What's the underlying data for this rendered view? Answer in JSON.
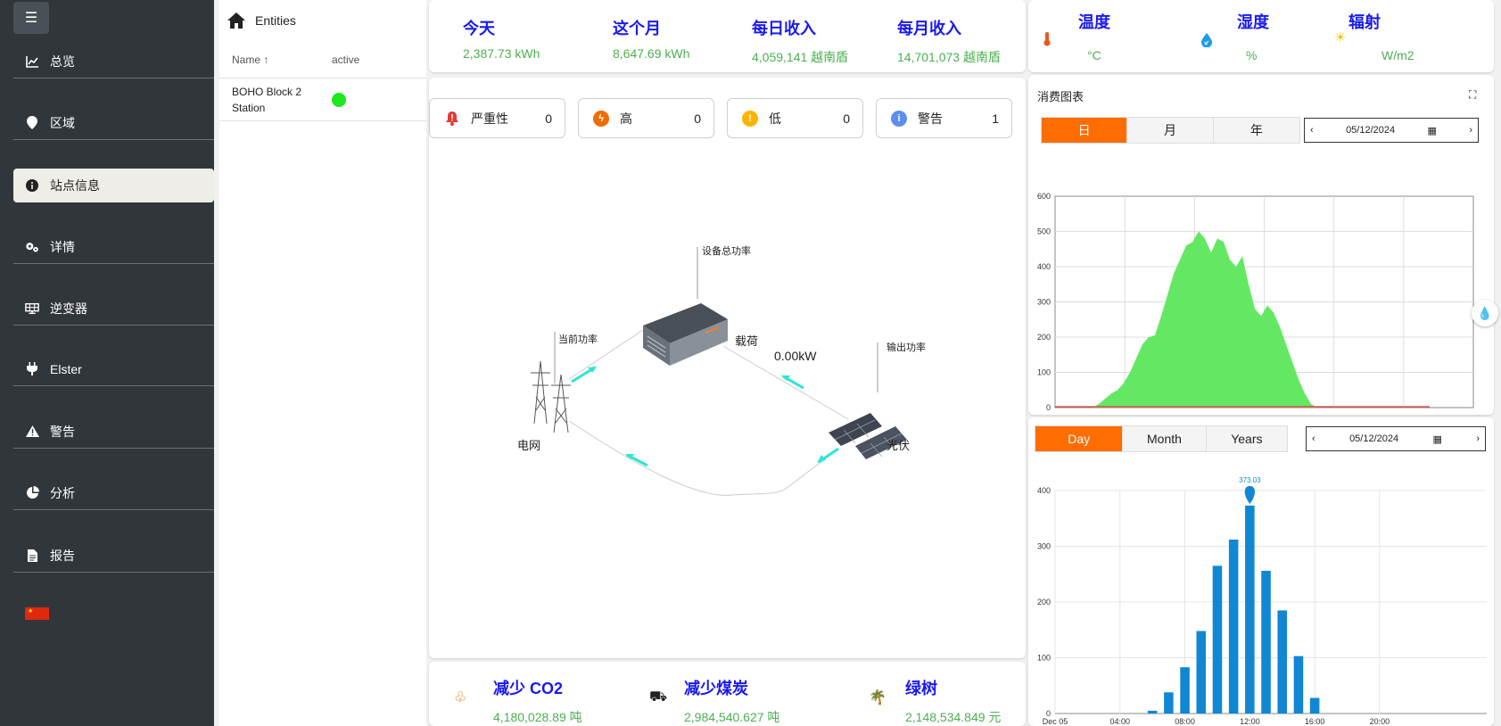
{
  "sidebar": {
    "menu_icon": "hamburger-icon",
    "items": [
      {
        "label": "总览",
        "icon": "line-chart-icon"
      },
      {
        "label": "区域",
        "icon": "map-pin-icon"
      },
      {
        "label": "站点信息",
        "icon": "info-icon",
        "active": true
      },
      {
        "label": "详情",
        "icon": "gears-icon"
      },
      {
        "label": "逆变器",
        "icon": "solar-panel-icon"
      },
      {
        "label": "Elster",
        "icon": "plug-icon"
      },
      {
        "label": "警告",
        "icon": "warning-icon"
      },
      {
        "label": "分析",
        "icon": "pie-chart-icon"
      },
      {
        "label": "报告",
        "icon": "document-icon"
      }
    ],
    "language_flag": "china-flag-icon"
  },
  "entities": {
    "title": "Entities",
    "columns": {
      "name": "Name ↑",
      "active": "active"
    },
    "rows": [
      {
        "name": "BOHO Block 2 Station",
        "active_color": "#1ee81e"
      }
    ]
  },
  "kpis": [
    {
      "label": "今天",
      "value": "2,387.73 kWh"
    },
    {
      "label": "这个月",
      "value": "8,647.69 kWh"
    },
    {
      "label": "每日收入",
      "value": "4,059,141 越南盾"
    },
    {
      "label": "每月收入",
      "value": "14,701,073 越南盾"
    }
  ],
  "weather": [
    {
      "label": "温度",
      "unit": "°C",
      "icon": "thermometer-icon"
    },
    {
      "label": "湿度",
      "unit": "%",
      "icon": "humidity-icon"
    },
    {
      "label": "辐射",
      "unit": "W/m2",
      "icon": "sun-icon"
    }
  ],
  "alarms": [
    {
      "label": "严重性",
      "count": "0",
      "icon": "bell-icon",
      "color": "#e53935"
    },
    {
      "label": "高",
      "count": "0",
      "icon": "bolt-icon",
      "color": "#ef6c00"
    },
    {
      "label": "低",
      "count": "0",
      "icon": "exclamation-icon",
      "color": "#ffb300"
    },
    {
      "label": "警告",
      "count": "1",
      "icon": "info-icon",
      "color": "#5c8ef2"
    }
  ],
  "diagram": {
    "device_power": "设备总功率",
    "current_power": "当前功率",
    "load": "载荷",
    "load_value": "0.00kW",
    "output_power": "输出功率",
    "grid": "电网",
    "pv": "光伏"
  },
  "consumption_chart": {
    "title": "消费图表",
    "tabs": [
      "日",
      "月",
      "年"
    ],
    "active_tab": "日",
    "date": "05/12/2024"
  },
  "production_chart": {
    "tabs": [
      "Day",
      "Month",
      "Years"
    ],
    "active_tab": "Day",
    "date": "05/12/2024"
  },
  "chart_data": [
    {
      "type": "area",
      "title": "",
      "ylim": [
        0,
        600
      ],
      "yticks": [
        "600",
        "500",
        "400",
        "300",
        "200",
        "100",
        "0"
      ],
      "x": [
        0,
        6,
        7,
        8,
        9,
        10,
        11,
        12,
        13,
        14,
        15,
        16,
        17,
        18,
        19,
        20,
        21,
        22,
        23,
        24,
        25,
        26,
        27,
        28,
        29,
        30,
        31,
        32,
        33,
        34,
        35,
        36,
        37,
        38,
        39,
        40,
        41,
        42,
        43,
        44,
        45,
        46,
        47,
        48,
        49,
        50,
        51,
        52,
        53,
        54,
        55,
        58,
        63,
        67
      ],
      "series": [
        {
          "values": [
            0,
            0,
            10,
            25,
            40,
            50,
            70,
            100,
            140,
            180,
            200,
            205,
            260,
            320,
            380,
            420,
            460,
            470,
            500,
            480,
            440,
            480,
            470,
            420,
            400,
            430,
            350,
            280,
            260,
            290,
            270,
            230,
            180,
            130,
            80,
            40,
            10,
            0,
            0,
            0,
            0,
            0,
            0,
            0,
            0,
            0,
            0,
            0,
            0,
            0,
            0,
            0,
            0,
            0
          ],
          "color": "#64e864"
        }
      ]
    },
    {
      "type": "bar",
      "title": "",
      "ylim": [
        0,
        400
      ],
      "yticks": [
        "400",
        "300",
        "200",
        "100",
        "0"
      ],
      "xticks": [
        "Dec 05",
        "04:00",
        "08:00",
        "12:00",
        "16:00",
        "20:00"
      ],
      "hours": [
        6,
        7,
        8,
        9,
        10,
        11,
        12,
        13,
        14,
        15,
        16
      ],
      "values": [
        5,
        38,
        83,
        148,
        265,
        312,
        373.03,
        256,
        185,
        103,
        28
      ],
      "max_label": "373.03",
      "color": "#1187d4"
    }
  ],
  "bottom_stats": [
    {
      "label": "减少 CO2",
      "value": "4,180,028.89 吨",
      "icon": "tree-icon"
    },
    {
      "label": "减少煤炭",
      "value": "2,984,540.627 吨",
      "icon": "coal-cart-icon"
    },
    {
      "label": "绿树",
      "value": "2,148,534.849 元",
      "icon": "palm-tree-icon"
    }
  ]
}
